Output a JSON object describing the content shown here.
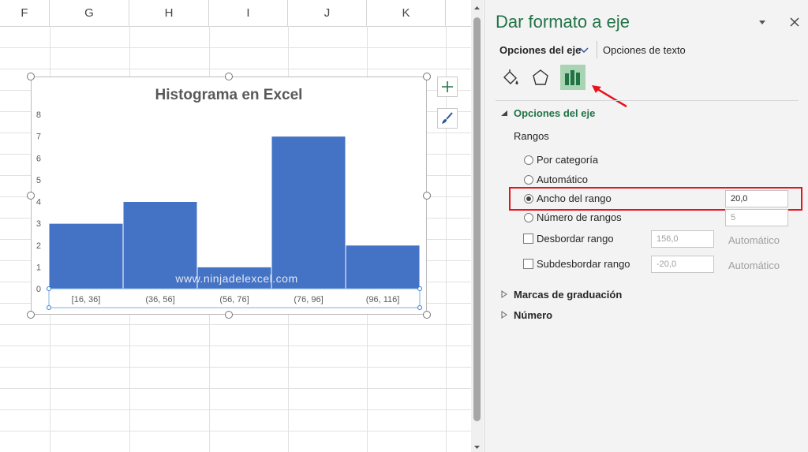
{
  "sheet": {
    "columns": [
      "F",
      "G",
      "H",
      "I",
      "J",
      "K"
    ]
  },
  "chart_data": {
    "type": "bar",
    "title": "Histograma en Excel",
    "categories": [
      "[16, 36]",
      "(36, 56]",
      "(56, 76]",
      "(76, 96]",
      "(96, 116]"
    ],
    "values": [
      3,
      4,
      1,
      7,
      2
    ],
    "ylim": [
      0,
      8
    ],
    "yticks": [
      0,
      1,
      2,
      3,
      4,
      5,
      6,
      7,
      8
    ],
    "bar_color": "#4472C4",
    "watermark": "www.ninjadelexcel.com",
    "grid": false
  },
  "pane": {
    "title": "Dar formato a eje",
    "tab_axis": "Opciones del eje",
    "tab_text": "Opciones de texto",
    "section_axis": "Opciones del eje",
    "bins_label": "Rangos",
    "opt_category": "Por categoría",
    "opt_auto": "Automático",
    "opt_width": "Ancho del rango",
    "width_value": "20,0",
    "opt_number": "Número de rangos",
    "number_value": "5",
    "overflow_label": "Desbordar rango",
    "overflow_value": "156,0",
    "overflow_auto": "Automático",
    "underflow_label": "Subdesbordar rango",
    "underflow_value": "-20,0",
    "underflow_auto": "Automático",
    "section_ticks": "Marcas de graduación",
    "section_number": "Número",
    "accent": "#217346",
    "highlight": "#e8121c"
  }
}
